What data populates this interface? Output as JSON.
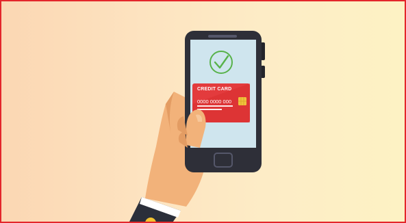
{
  "card": {
    "title": "CREDIT CARD",
    "number": "0000 0000 000"
  },
  "colors": {
    "frame_border": "#e3262b",
    "background_left": "#fbd7b3",
    "background_right": "#fdf2c4",
    "phone_body": "#2e2f38",
    "phone_screen": "#cfe5ee",
    "checkmark": "#58b24a",
    "card_red": "#e33b3d",
    "card_chip": "#f0c23c",
    "skin": "#f2b27a",
    "sleeve": "#2b2f3a"
  },
  "icons": [
    "checkmark-icon",
    "card-chip-icon"
  ]
}
